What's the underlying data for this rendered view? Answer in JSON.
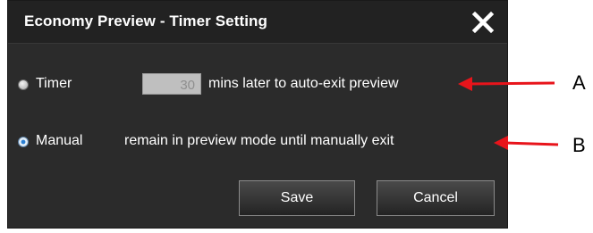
{
  "dialog": {
    "title": "Economy Preview - Timer Setting",
    "close_icon": "close-icon"
  },
  "timer_option": {
    "label": "Timer",
    "selected": false,
    "input_value": "30",
    "description": "mins later to auto-exit preview"
  },
  "manual_option": {
    "label": "Manual",
    "selected": true,
    "description": "remain in preview mode until manually exit"
  },
  "buttons": {
    "save_label": "Save",
    "cancel_label": "Cancel"
  },
  "annotations": {
    "a_label": "A",
    "b_label": "B",
    "arrow_color": "#e8141b"
  },
  "colors": {
    "dialog_bg": "#2b2b2b",
    "titlebar_bg": "#222222",
    "text": "#ffffff",
    "radio_accent": "#2a7fd4"
  }
}
